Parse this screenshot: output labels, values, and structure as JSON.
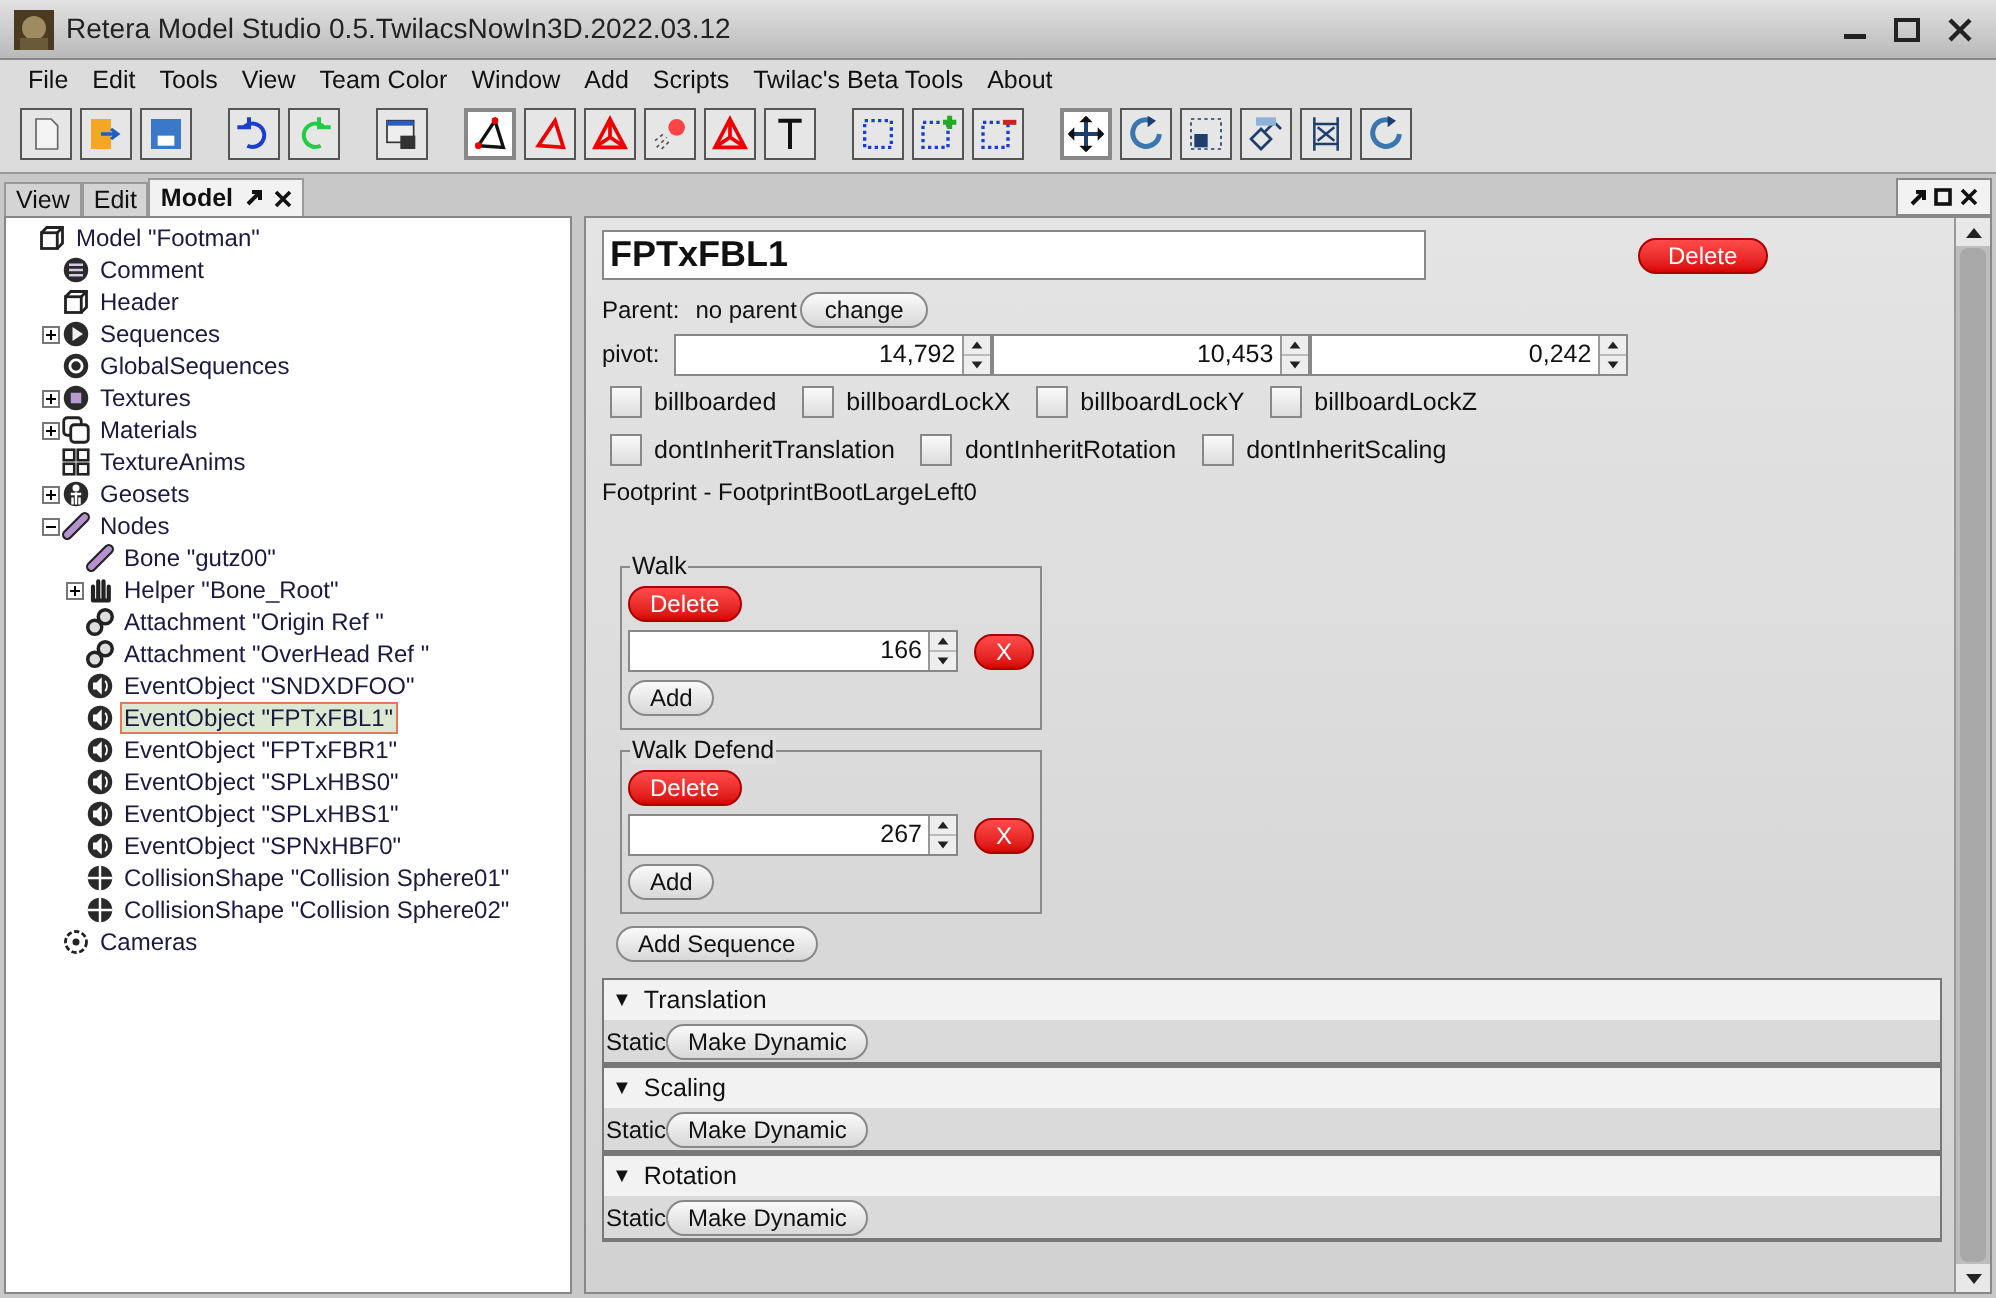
{
  "window": {
    "title": "Retera Model Studio 0.5.TwilacsNowIn3D.2022.03.12"
  },
  "menu": [
    "File",
    "Edit",
    "Tools",
    "View",
    "Team Color",
    "Window",
    "Add",
    "Scripts",
    "Twilac's Beta Tools",
    "About"
  ],
  "toolbar": [
    {
      "kind": "new",
      "selected": false
    },
    {
      "kind": "open",
      "selected": false
    },
    {
      "kind": "save",
      "selected": false
    },
    {
      "kind": "gap"
    },
    {
      "kind": "undo",
      "selected": false
    },
    {
      "kind": "redo",
      "selected": false
    },
    {
      "kind": "gap"
    },
    {
      "kind": "lock",
      "selected": false
    },
    {
      "kind": "gap"
    },
    {
      "kind": "vertex",
      "selected": true
    },
    {
      "kind": "face",
      "selected": false
    },
    {
      "kind": "group",
      "selected": false
    },
    {
      "kind": "cluster",
      "selected": false
    },
    {
      "kind": "group",
      "selected": false
    },
    {
      "kind": "text",
      "selected": false
    },
    {
      "kind": "gap"
    },
    {
      "kind": "box",
      "selected": false
    },
    {
      "kind": "box-add",
      "selected": false
    },
    {
      "kind": "box-remove",
      "selected": false
    },
    {
      "kind": "gap"
    },
    {
      "kind": "move",
      "selected": true
    },
    {
      "kind": "rotate",
      "selected": false
    },
    {
      "kind": "scale",
      "selected": false
    },
    {
      "kind": "extrude",
      "selected": false
    },
    {
      "kind": "extend",
      "selected": false
    },
    {
      "kind": "rotate",
      "selected": false
    }
  ],
  "tabs": [
    {
      "label": "View",
      "selected": false
    },
    {
      "label": "Edit",
      "selected": false
    },
    {
      "label": "Model",
      "selected": true
    }
  ],
  "tree": [
    {
      "label": "Model \"Footman\"",
      "kind": "cube",
      "selected": false,
      "children": [
        {
          "label": "Comment",
          "kind": "lines",
          "selected": false
        },
        {
          "label": "Header",
          "kind": "cube",
          "selected": false
        },
        {
          "label": "Sequences",
          "kind": "play",
          "selected": false,
          "expanded": false
        },
        {
          "label": "GlobalSequences",
          "kind": "loop",
          "selected": false
        },
        {
          "label": "Textures",
          "kind": "square",
          "selected": false,
          "expanded": false
        },
        {
          "label": "Materials",
          "kind": "layers",
          "selected": false,
          "expanded": false
        },
        {
          "label": "TextureAnims",
          "kind": "grid",
          "selected": false
        },
        {
          "label": "Geosets",
          "kind": "figure",
          "selected": false,
          "expanded": false
        },
        {
          "label": "Nodes",
          "kind": "bone",
          "selected": false,
          "expanded": true,
          "children": [
            {
              "label": "Bone \"gutz00\"",
              "kind": "bone",
              "selected": false
            },
            {
              "label": "Helper \"Bone_Root\"",
              "kind": "hand",
              "selected": false,
              "expanded": false
            },
            {
              "label": "Attachment \"Origin Ref \"",
              "kind": "link",
              "selected": false
            },
            {
              "label": "Attachment \"OverHead Ref \"",
              "kind": "link",
              "selected": false
            },
            {
              "label": "EventObject \"SNDXDFOO\"",
              "kind": "sound",
              "selected": false
            },
            {
              "label": "EventObject \"FPTxFBL1\"",
              "kind": "sound",
              "selected": true
            },
            {
              "label": "EventObject \"FPTxFBR1\"",
              "kind": "sound",
              "selected": false
            },
            {
              "label": "EventObject \"SPLxHBS0\"",
              "kind": "sound",
              "selected": false
            },
            {
              "label": "EventObject \"SPLxHBS1\"",
              "kind": "sound",
              "selected": false
            },
            {
              "label": "EventObject \"SPNxHBF0\"",
              "kind": "sound",
              "selected": false
            },
            {
              "label": "CollisionShape \"Collision Sphere01\"",
              "kind": "cross",
              "selected": false
            },
            {
              "label": "CollisionShape \"Collision Sphere02\"",
              "kind": "cross",
              "selected": false
            }
          ]
        },
        {
          "label": "Cameras",
          "kind": "camera",
          "selected": false
        }
      ]
    }
  ],
  "editor": {
    "name": "FPTxFBL1",
    "delete": "Delete",
    "parent_label": "Parent:",
    "parent_value": "no parent",
    "change": "change",
    "pivot_label": "pivot:",
    "pivot": [
      "14,792",
      "10,453",
      "0,242"
    ],
    "flags": [
      [
        {
          "label": "billboarded",
          "checked": false
        },
        {
          "label": "billboardLockX",
          "checked": false
        },
        {
          "label": "billboardLockY",
          "checked": false
        },
        {
          "label": "billboardLockZ",
          "checked": false
        }
      ],
      [
        {
          "label": "dontInheritTranslation",
          "checked": false
        },
        {
          "label": "dontInheritRotation",
          "checked": false
        },
        {
          "label": "dontInheritScaling",
          "checked": false
        }
      ]
    ],
    "event_info": "Footprint - FootprintBootLargeLeft0",
    "sequences": [
      {
        "title": "Walk",
        "delete": "Delete",
        "times": [
          {
            "value": "166",
            "remove": "X"
          }
        ],
        "add": "Add"
      },
      {
        "title": "Walk Defend",
        "delete": "Delete",
        "times": [
          {
            "value": "267",
            "remove": "X"
          }
        ],
        "add": "Add"
      }
    ],
    "add_sequence": "Add Sequence",
    "animations": [
      {
        "title": "Translation",
        "expanded": true,
        "toggle": "▼",
        "status": "Static",
        "button": "Make Dynamic"
      },
      {
        "title": "Scaling",
        "expanded": true,
        "toggle": "▼",
        "status": "Static",
        "button": "Make Dynamic"
      },
      {
        "title": "Rotation",
        "expanded": true,
        "toggle": "▼",
        "status": "Static",
        "button": "Make Dynamic"
      }
    ]
  }
}
